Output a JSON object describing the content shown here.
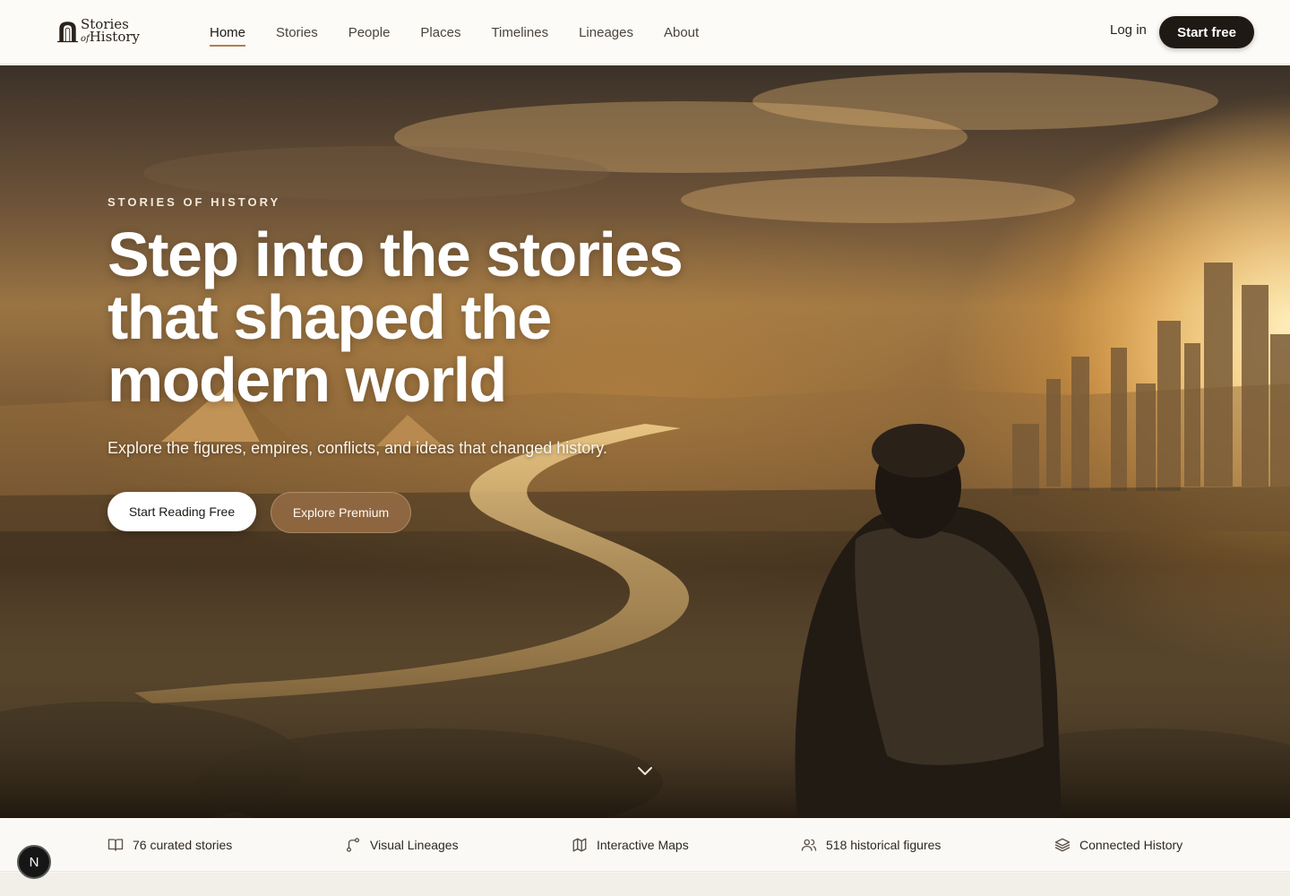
{
  "brand": {
    "line1": "Stories",
    "line2_of": "of",
    "line2": "History"
  },
  "nav": {
    "items": [
      {
        "label": "Home",
        "active": true
      },
      {
        "label": "Stories"
      },
      {
        "label": "People"
      },
      {
        "label": "Places"
      },
      {
        "label": "Timelines"
      },
      {
        "label": "Lineages"
      },
      {
        "label": "About"
      }
    ],
    "login_label": "Log in",
    "start_label": "Start free"
  },
  "hero": {
    "eyebrow": "STORIES OF HISTORY",
    "headline": "Step into the stories that shaped the modern world",
    "subhead": "Explore the figures, empires, conflicts, and ideas that changed history.",
    "primary_cta": "Start Reading Free",
    "secondary_cta": "Explore Premium",
    "scroll_icon": "chevron-down-icon"
  },
  "features": [
    {
      "icon": "book-open-icon",
      "label": "76 curated stories"
    },
    {
      "icon": "git-branch-icon",
      "label": "Visual Lineages"
    },
    {
      "icon": "map-icon",
      "label": "Interactive Maps"
    },
    {
      "icon": "users-icon",
      "label": "518 historical figures"
    },
    {
      "icon": "layers-icon",
      "label": "Connected History"
    }
  ],
  "badge": {
    "letter": "N"
  },
  "colors": {
    "accent": "#b0804e",
    "dark": "#1f1914",
    "premium": "#9b7048"
  }
}
